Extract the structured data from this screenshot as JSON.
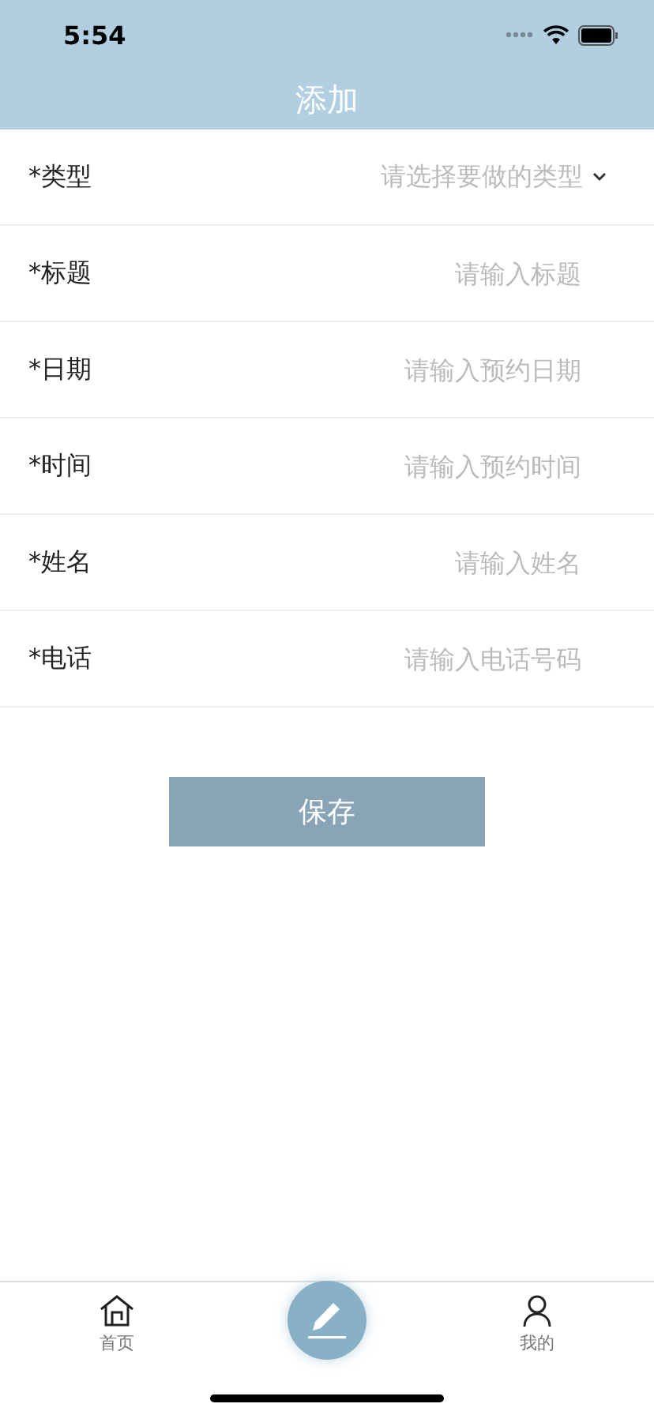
{
  "status_bar": {
    "time": "5:54"
  },
  "header": {
    "title": "添加"
  },
  "fields": [
    {
      "kind": "select",
      "label": "*类型",
      "placeholder": "请选择要做的类型"
    },
    {
      "kind": "input",
      "label": "*标题",
      "placeholder": "请输入标题"
    },
    {
      "kind": "input",
      "label": "*日期",
      "placeholder": "请输入预约日期"
    },
    {
      "kind": "input",
      "label": "*时间",
      "placeholder": "请输入预约时间"
    },
    {
      "kind": "input",
      "label": "*姓名",
      "placeholder": "请输入姓名"
    },
    {
      "kind": "input",
      "label": "*电话",
      "placeholder": "请输入电话号码"
    }
  ],
  "save_button": "保存",
  "tab_bar": [
    {
      "kind": "home",
      "label": "首页"
    },
    {
      "kind": "compose"
    },
    {
      "kind": "profile",
      "label": "我的"
    }
  ]
}
